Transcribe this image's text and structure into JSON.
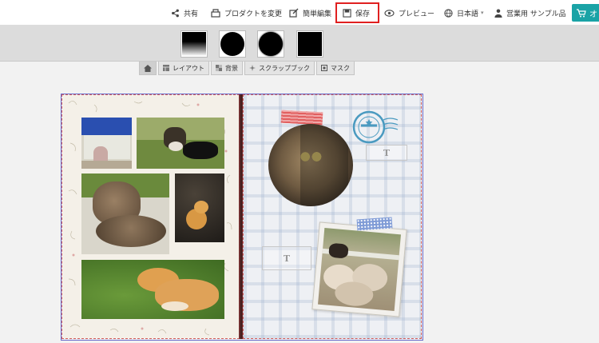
{
  "topbar": {
    "share": "共有",
    "change_product": "プロダクトを変更",
    "easy_edit": "簡単編集",
    "save": "保存",
    "preview": "プレビュー",
    "language": "日本語",
    "sample": "営業用 サンプル品",
    "cart": "オ"
  },
  "tabs": [
    {
      "label": ""
    },
    {
      "label": "レイアウト"
    },
    {
      "label": "背景"
    },
    {
      "label": "スクラップブック"
    },
    {
      "label": "マスク"
    }
  ],
  "right_page": {
    "text_frame_1": "T",
    "text_frame_2": "T"
  },
  "colors": {
    "accent": "#1aa3a6",
    "highlight": "#e02020",
    "book_border": "#6a6acb"
  }
}
